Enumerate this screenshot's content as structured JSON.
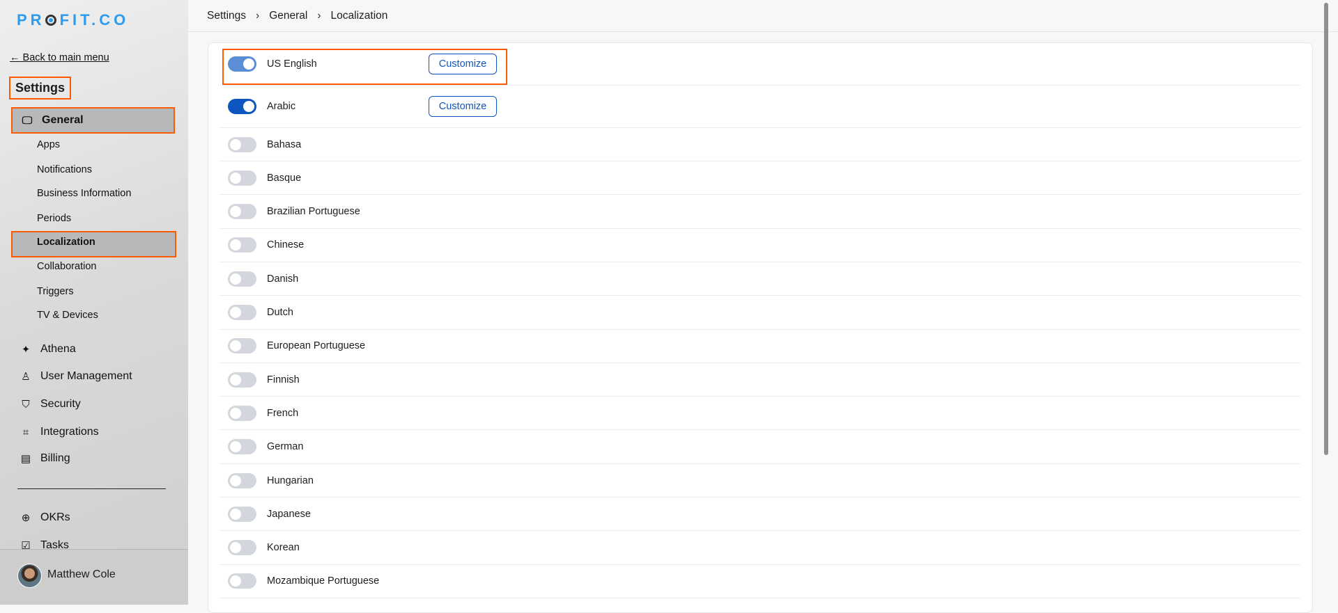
{
  "logo": "PROFIT.CO",
  "sidebar": {
    "back": "← Back to main menu",
    "title": "Settings",
    "general": "General",
    "sub": [
      "Apps",
      "Notifications",
      "Business Information",
      "Periods",
      "Localization",
      "Collaboration",
      "Triggers",
      "TV & Devices"
    ],
    "main": [
      {
        "label": "Athena",
        "icon": "sparkle-icon"
      },
      {
        "label": "User Management",
        "icon": "user-icon"
      },
      {
        "label": "Security",
        "icon": "shield-icon"
      },
      {
        "label": "Integrations",
        "icon": "chip-icon"
      },
      {
        "label": "Billing",
        "icon": "receipt-icon"
      }
    ],
    "apps": [
      {
        "label": "OKRs",
        "icon": "target-icon"
      },
      {
        "label": "Tasks",
        "icon": "clipboard-check-icon"
      }
    ],
    "user": "Matthew Cole"
  },
  "breadcrumb": [
    "Settings",
    "General",
    "Localization"
  ],
  "customize_label": "Customize",
  "languages": [
    {
      "name": "US English",
      "enabled": true
    },
    {
      "name": "Arabic",
      "enabled": true
    },
    {
      "name": "Bahasa",
      "enabled": false
    },
    {
      "name": "Basque",
      "enabled": false
    },
    {
      "name": "Brazilian Portuguese",
      "enabled": false
    },
    {
      "name": "Chinese",
      "enabled": false
    },
    {
      "name": "Danish",
      "enabled": false
    },
    {
      "name": "Dutch",
      "enabled": false
    },
    {
      "name": "European Portuguese",
      "enabled": false
    },
    {
      "name": "Finnish",
      "enabled": false
    },
    {
      "name": "French",
      "enabled": false
    },
    {
      "name": "German",
      "enabled": false
    },
    {
      "name": "Hungarian",
      "enabled": false
    },
    {
      "name": "Japanese",
      "enabled": false
    },
    {
      "name": "Korean",
      "enabled": false
    },
    {
      "name": "Mozambique Portuguese",
      "enabled": false
    }
  ],
  "colors": {
    "accent": "#0d55bf",
    "highlight": "#ff5a00",
    "brand": "#2d9bf0"
  }
}
